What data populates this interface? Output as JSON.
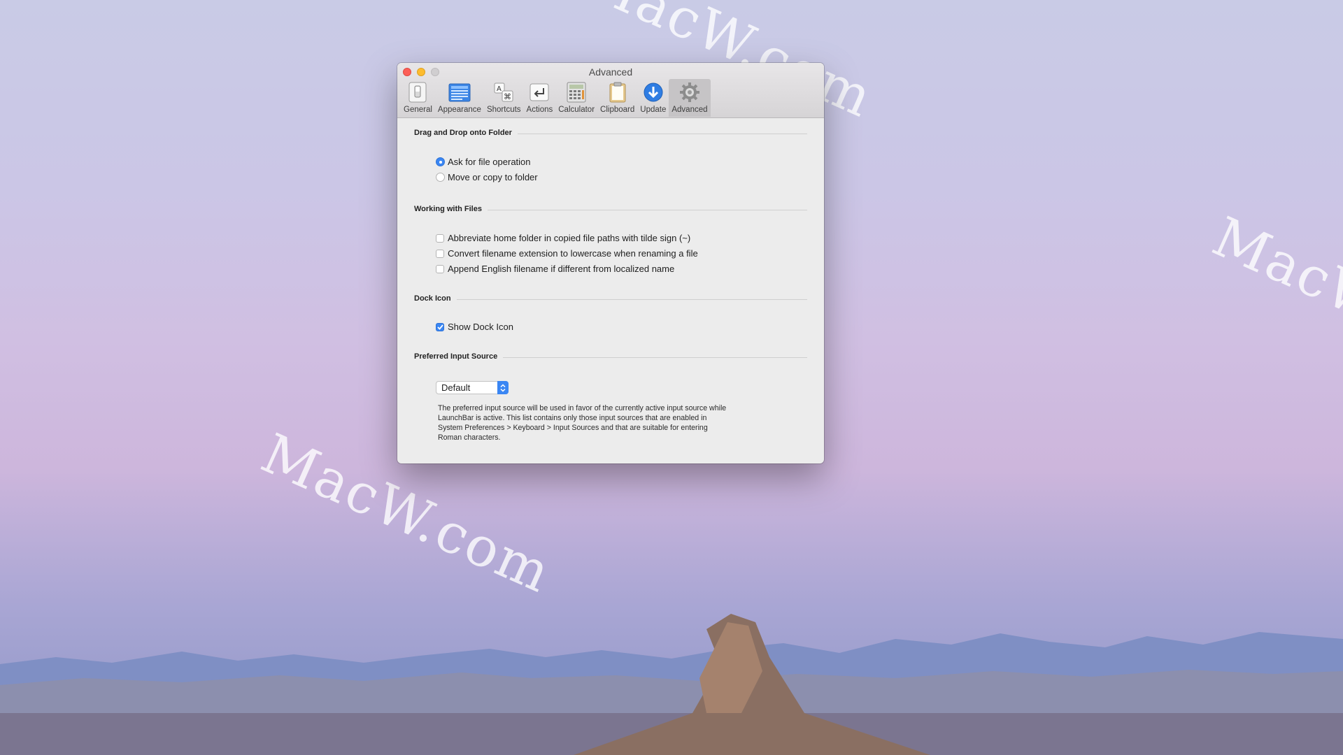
{
  "watermark": "MacW.com",
  "window": {
    "title": "Advanced",
    "toolbar": [
      {
        "label": "General",
        "icon": "general-switch-icon"
      },
      {
        "label": "Appearance",
        "icon": "appearance-icon"
      },
      {
        "label": "Shortcuts",
        "icon": "shortcuts-icon"
      },
      {
        "label": "Actions",
        "icon": "actions-icon"
      },
      {
        "label": "Calculator",
        "icon": "calculator-icon"
      },
      {
        "label": "Clipboard",
        "icon": "clipboard-icon"
      },
      {
        "label": "Update",
        "icon": "update-download-icon"
      },
      {
        "label": "Advanced",
        "icon": "gear-icon",
        "selected": true
      }
    ]
  },
  "sections": {
    "drag_drop": {
      "title": "Drag and Drop onto Folder",
      "options": [
        "Ask for file operation",
        "Move or copy to folder"
      ],
      "selected_index": 0
    },
    "working_files": {
      "title": "Working with Files",
      "options": [
        {
          "label": "Abbreviate home folder in copied file paths with tilde sign (~)",
          "checked": false
        },
        {
          "label": "Convert filename extension to lowercase when renaming a file",
          "checked": false
        },
        {
          "label": "Append English filename if different from localized name",
          "checked": false
        }
      ]
    },
    "dock_icon": {
      "title": "Dock Icon",
      "option": {
        "label": "Show Dock Icon",
        "checked": true
      }
    },
    "input_source": {
      "title": "Preferred Input Source",
      "selected": "Default",
      "note": "The preferred input source will be used in favor of the currently active input source while LaunchBar is active. This list contains only those input sources that are enabled in System Preferences > Keyboard > Input Sources and that are suitable for entering Roman characters."
    }
  },
  "colors": {
    "accent": "#3a86f3",
    "close": "#fc5f57",
    "minimize": "#fdbc2e"
  }
}
